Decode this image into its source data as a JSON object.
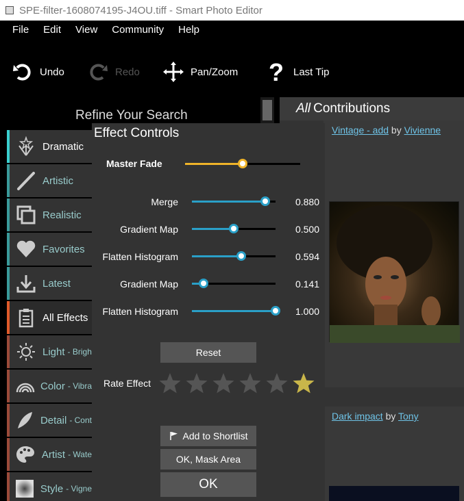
{
  "window": {
    "title": "SPE-filter-1608074195-J4OU.tiff - Smart Photo Editor"
  },
  "menu": [
    "File",
    "Edit",
    "View",
    "Community",
    "Help"
  ],
  "toolbar": {
    "undo": "Undo",
    "redo": "Redo",
    "panzoom": "Pan/Zoom",
    "lasttip": "Last Tip"
  },
  "sidebar": {
    "title": "Refine Your Search",
    "items": [
      {
        "label": "Dramatic",
        "sub": "",
        "icon": "sparkle-icon",
        "accent": "#3ad0d0"
      },
      {
        "label": "Artistic",
        "sub": "",
        "icon": "brush-icon",
        "accent": "#3a9a9a"
      },
      {
        "label": "Realistic",
        "sub": "",
        "icon": "frames-icon",
        "accent": "#3a9a9a"
      },
      {
        "label": "Favorites",
        "sub": "",
        "icon": "heart-icon",
        "accent": "#3a9a9a"
      },
      {
        "label": "Latest",
        "sub": "",
        "icon": "download-icon",
        "accent": "#3a9a9a"
      },
      {
        "label": "All Effects",
        "sub": "",
        "icon": "clipboard-icon",
        "accent": "#e05a2a"
      },
      {
        "label": "Light",
        "sub": "- Brigh",
        "icon": "sun-icon",
        "accent": "#9a4a3a"
      },
      {
        "label": "Color",
        "sub": "- Vibra",
        "icon": "rainbow-icon",
        "accent": "#9a4a3a"
      },
      {
        "label": "Detail",
        "sub": "- Cont",
        "icon": "feather-icon",
        "accent": "#9a4a3a"
      },
      {
        "label": "Artist",
        "sub": "- Wate",
        "icon": "palette-icon",
        "accent": "#9a4a3a"
      },
      {
        "label": "Style",
        "sub": "- Vigne",
        "icon": "vignette-icon",
        "accent": "#9a4a3a"
      }
    ]
  },
  "contributions": {
    "all_word": "All",
    "header_rest": "Contributions",
    "cards": [
      {
        "effect": "Vintage - add",
        "by": "by",
        "author": "Vivienne"
      },
      {
        "effect": "Dark impact",
        "by": "by",
        "author": "Tony"
      }
    ]
  },
  "effect_controls": {
    "title": "Effect Controls",
    "master_fade": {
      "label": "Master Fade",
      "value": 0.5,
      "color": "#f0b429"
    },
    "params": [
      {
        "label": "Merge",
        "value": 0.88,
        "display": "0.880"
      },
      {
        "label": "Gradient Map",
        "value": 0.5,
        "display": "0.500"
      },
      {
        "label": "Flatten Histogram",
        "value": 0.594,
        "display": "0.594"
      },
      {
        "label": "Gradient Map",
        "value": 0.141,
        "display": "0.141"
      },
      {
        "label": "Flatten Histogram",
        "value": 1.0,
        "display": "1.000"
      }
    ],
    "accent": "#2aa0c8",
    "reset": "Reset",
    "rate_label": "Rate Effect",
    "rating": 1,
    "add_shortlist": "Add to Shortlist",
    "ok_mask": "OK, Mask Area",
    "ok": "OK"
  }
}
